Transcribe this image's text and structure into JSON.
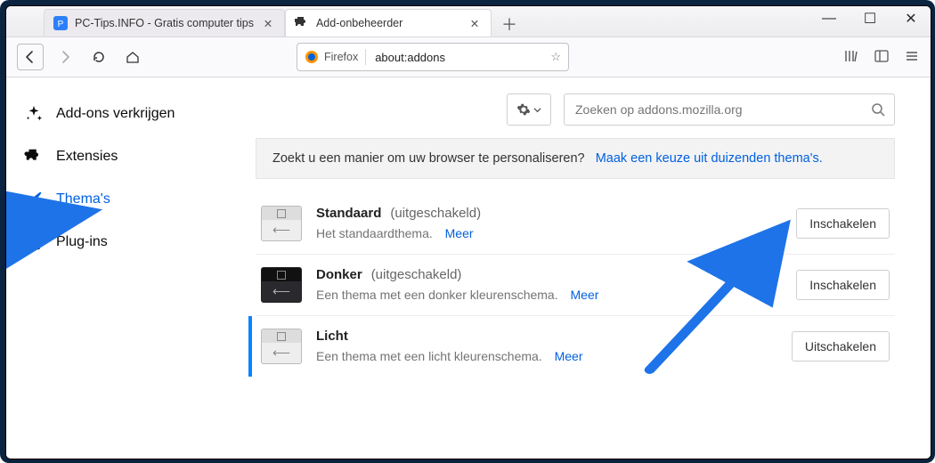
{
  "window": {
    "tabs": [
      {
        "title": "PC-Tips.INFO - Gratis computer tips",
        "active": false
      },
      {
        "title": "Add-onbeheerder",
        "active": true
      }
    ],
    "newtab_tooltip": "+"
  },
  "toolbar": {
    "identity_label": "Firefox",
    "url_value": "about:addons"
  },
  "sidebar": {
    "items": [
      {
        "icon": "sparkle",
        "label": "Add-ons verkrijgen"
      },
      {
        "icon": "puzzle",
        "label": "Extensies"
      },
      {
        "icon": "brush",
        "label": "Thema's",
        "active": true
      },
      {
        "icon": "plug",
        "label": "Plug-ins"
      }
    ]
  },
  "search": {
    "placeholder": "Zoeken op addons.mozilla.org"
  },
  "banner": {
    "text": "Zoekt u een manier om uw browser te personaliseren?",
    "link": "Maak een keuze uit duizenden thema's."
  },
  "themes": [
    {
      "name": "Standaard",
      "status": "(uitgeschakeld)",
      "desc": "Het standaardthema.",
      "more": "Meer",
      "button": "Inschakelen",
      "active": false,
      "variant": "light"
    },
    {
      "name": "Donker",
      "status": "(uitgeschakeld)",
      "desc": "Een thema met een donker kleurenschema.",
      "more": "Meer",
      "button": "Inschakelen",
      "active": false,
      "variant": "dark"
    },
    {
      "name": "Licht",
      "status": "",
      "desc": "Een thema met een licht kleurenschema.",
      "more": "Meer",
      "button": "Uitschakelen",
      "active": true,
      "variant": "light"
    }
  ]
}
